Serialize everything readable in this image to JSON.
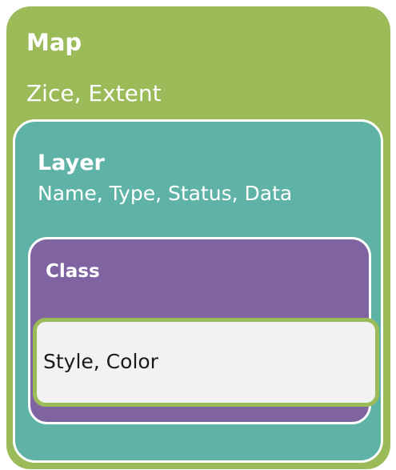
{
  "map": {
    "title": "Map",
    "properties": "Zice, Extent"
  },
  "layer": {
    "title": "Layer",
    "properties": "Name, Type, Status, Data"
  },
  "class": {
    "title": "Class"
  },
  "style": {
    "properties": "Style, Color"
  },
  "colors": {
    "map_green": "#9bbb59",
    "layer_teal": "#5fb3a6",
    "class_purple": "#8064a2",
    "style_fill": "#f2f2f2",
    "border_white": "#ffffff"
  }
}
